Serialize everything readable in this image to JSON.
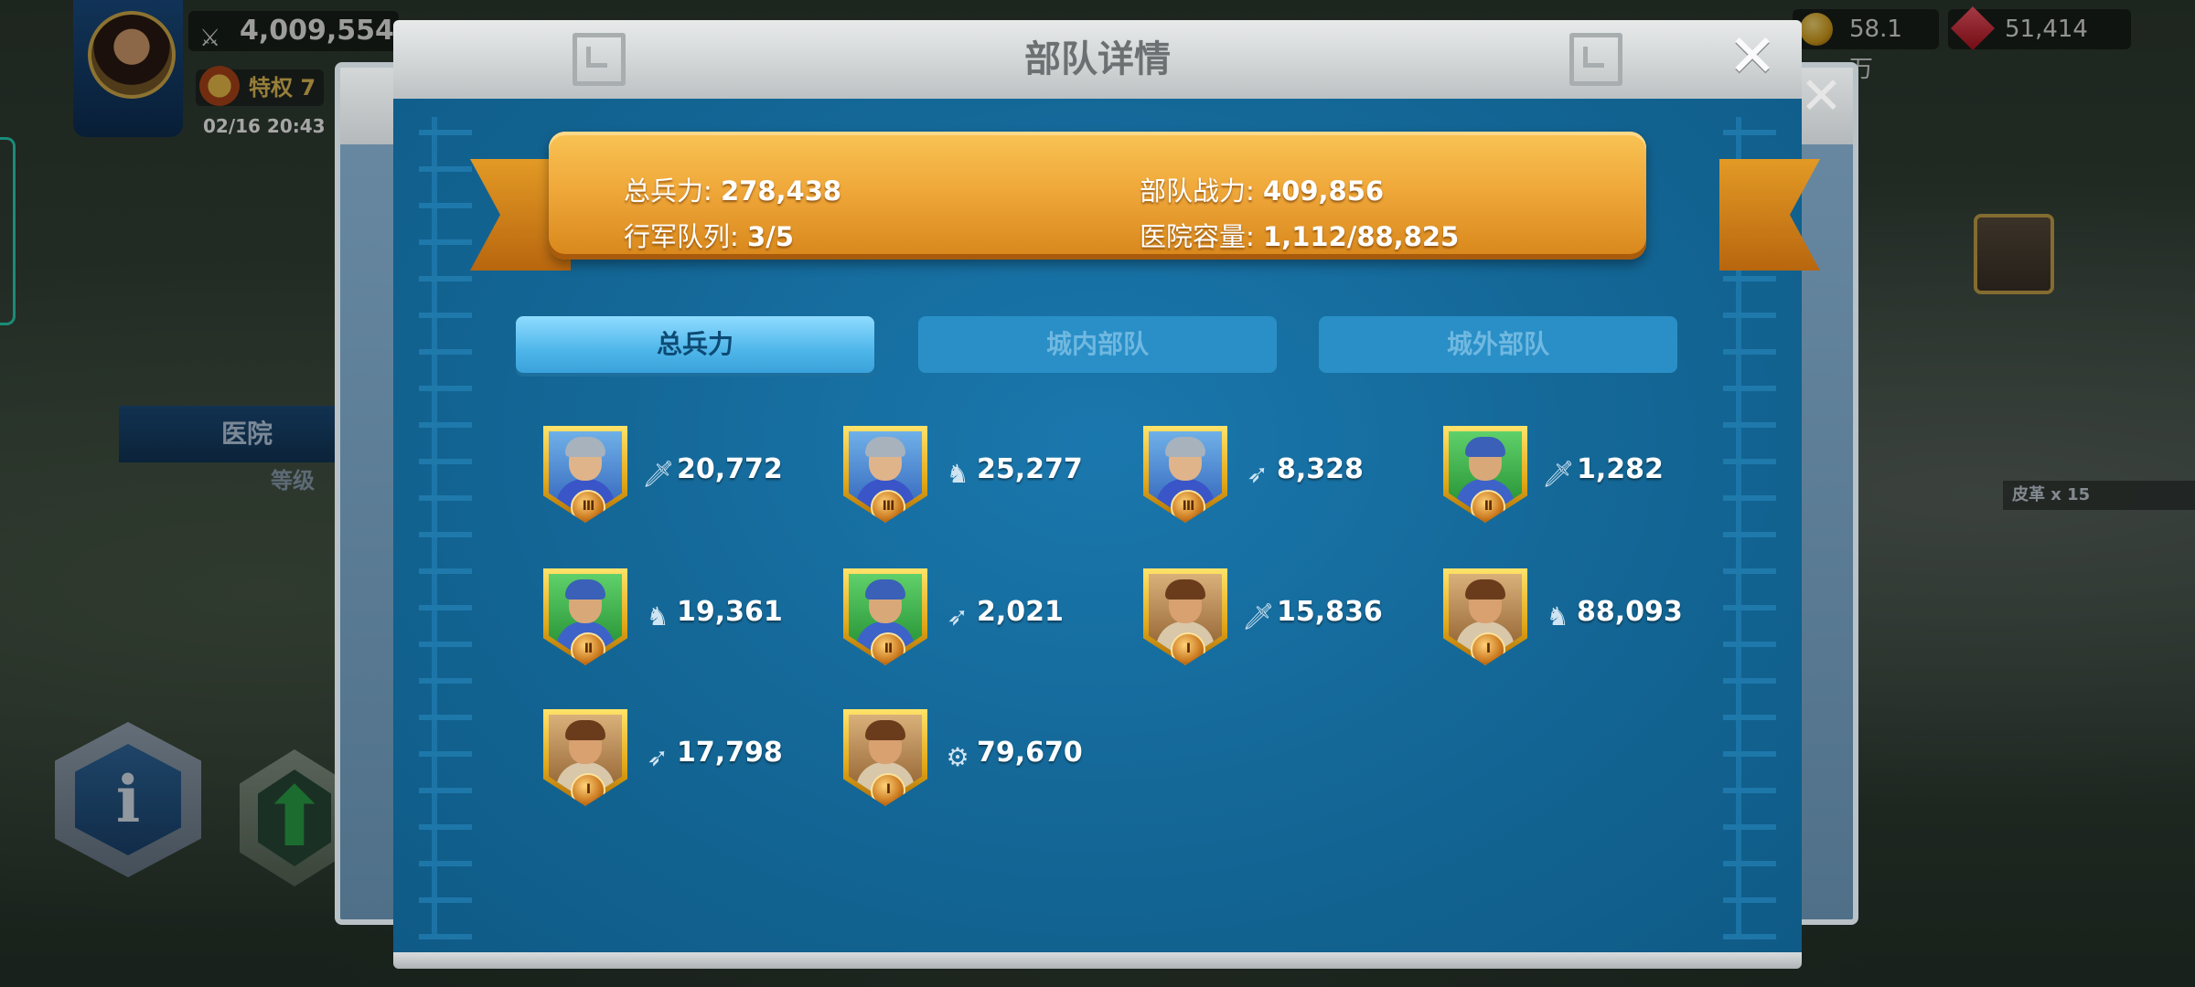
{
  "hud": {
    "power": "4,009,554",
    "vip": "特权 7",
    "datetime": "02/16 20:43",
    "gold": "58.1万",
    "gems": "51,414"
  },
  "background": {
    "hospital_banner": "医院",
    "hospital_level": "等级",
    "leather_reward": "皮革 x 15",
    "info_icon": "i"
  },
  "dialog": {
    "title": "部队详情",
    "close_label": "✕",
    "summary": {
      "total_troops_label": "总兵力:",
      "total_troops_value": "278,438",
      "troop_power_label": "部队战力:",
      "troop_power_value": "409,856",
      "march_queue_label": "行军队列:",
      "march_queue_value": "3/5",
      "hospital_capacity_label": "医院容量:",
      "hospital_capacity_value": "1,112/88,825"
    },
    "tabs": [
      {
        "label": "总兵力",
        "active": true
      },
      {
        "label": "城内部队",
        "active": false
      },
      {
        "label": "城外部队",
        "active": false
      }
    ],
    "troops": [
      {
        "type": "infantry",
        "tier": "III",
        "count": "20,772",
        "palette": "blue"
      },
      {
        "type": "cavalry",
        "tier": "III",
        "count": "25,277",
        "palette": "blue"
      },
      {
        "type": "archer",
        "tier": "III",
        "count": "8,328",
        "palette": "blue"
      },
      {
        "type": "infantry",
        "tier": "II",
        "count": "1,282",
        "palette": "green"
      },
      {
        "type": "cavalry",
        "tier": "II",
        "count": "19,361",
        "palette": "green"
      },
      {
        "type": "archer",
        "tier": "II",
        "count": "2,021",
        "palette": "green"
      },
      {
        "type": "infantry",
        "tier": "I",
        "count": "15,836",
        "palette": "tan"
      },
      {
        "type": "cavalry",
        "tier": "I",
        "count": "88,093",
        "palette": "tan"
      },
      {
        "type": "archer",
        "tier": "I",
        "count": "17,798",
        "palette": "tan"
      },
      {
        "type": "siege",
        "tier": "I",
        "count": "79,670",
        "palette": "tan"
      }
    ]
  },
  "icons": {
    "infantry": "sword-icon",
    "cavalry": "horse-icon",
    "archer": "bow-icon",
    "siege": "catapult-icon"
  },
  "colors": {
    "panel_blue": "#136695",
    "ribbon_gold": "#f0a83a",
    "tab_active": "#4fb6ea",
    "tab_inactive": "#2a8fc7"
  }
}
